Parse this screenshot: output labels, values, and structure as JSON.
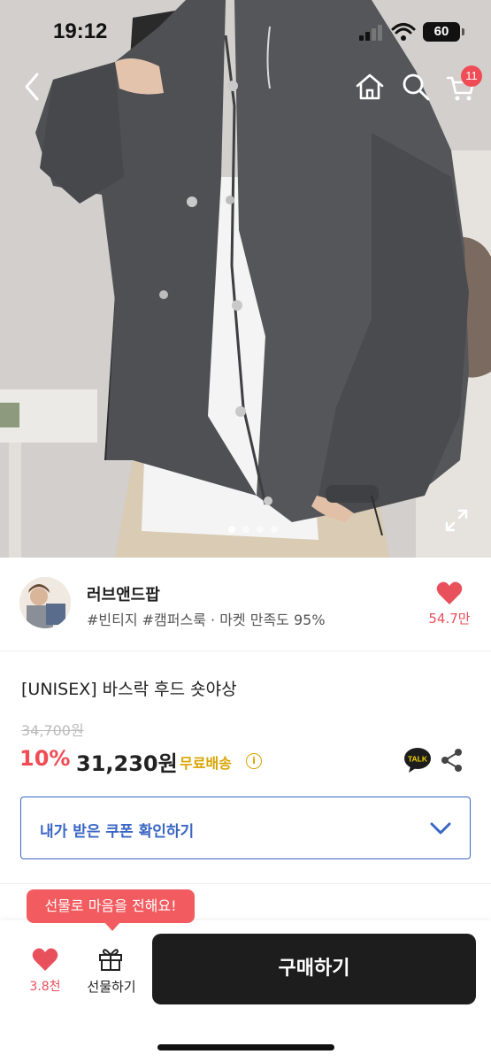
{
  "status_bar": {
    "time": "19:12",
    "battery": "60"
  },
  "header": {
    "icons": [
      "back-icon",
      "home-icon",
      "search-icon",
      "cart-icon"
    ],
    "cart_count": "11"
  },
  "gallery": {
    "image_count": 4,
    "active_index": 0
  },
  "store": {
    "name": "러브앤드팝",
    "tags": "#빈티지 #캠퍼스룩 · 마켓 만족도 95%",
    "like_count": "54.7만"
  },
  "product": {
    "title": "[UNISEX] 바스락 후드 숏야상",
    "original_price": "34,700원",
    "discount": "10%",
    "price": "31,230원",
    "shipping": "무료배송"
  },
  "coupon": {
    "label": "내가 받은 쿠폰 확인하기"
  },
  "bottom_bar": {
    "wish_count": "3.8천",
    "gift_label": "선물하기",
    "buy_label": "구매하기",
    "tooltip": "선물로 마음을 전해요!"
  },
  "colors": {
    "accent_red": "#f04c55",
    "coupon_blue": "#3a66c4",
    "shipping_yellow": "#d9a400",
    "buy_button": "#1d1d1d"
  }
}
